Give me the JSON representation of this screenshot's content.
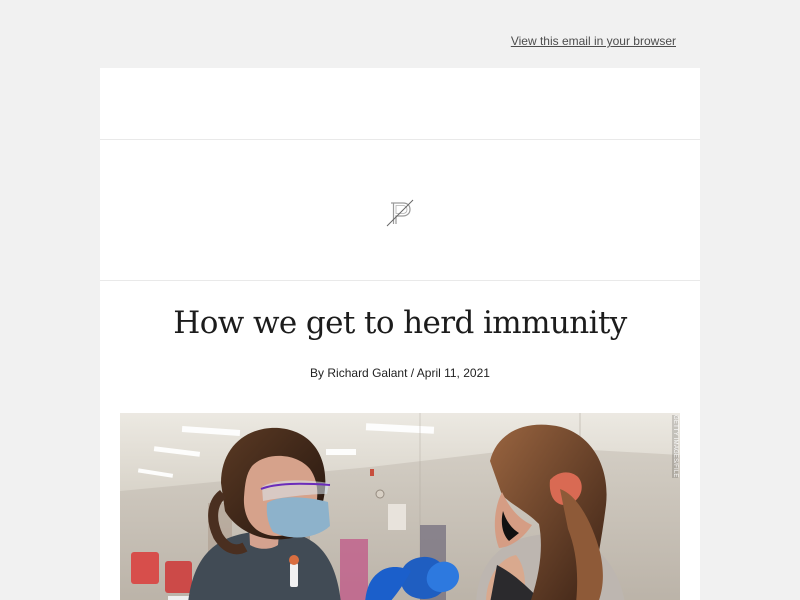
{
  "header": {
    "browser_link": "View this email in your browser"
  },
  "logo": {
    "icon": "p-monogram-icon"
  },
  "article": {
    "title": "How we get to herd immunity",
    "byline": "By Richard Galant / April 11, 2021"
  },
  "hero": {
    "photo_credit": "GETTY IMAGES/FILE",
    "description": "Healthcare worker administering vaccine"
  },
  "colors": {
    "page_background": "#f1f1f1",
    "card_background": "#ffffff",
    "link": "#4d4d4d",
    "text": "#222222"
  }
}
